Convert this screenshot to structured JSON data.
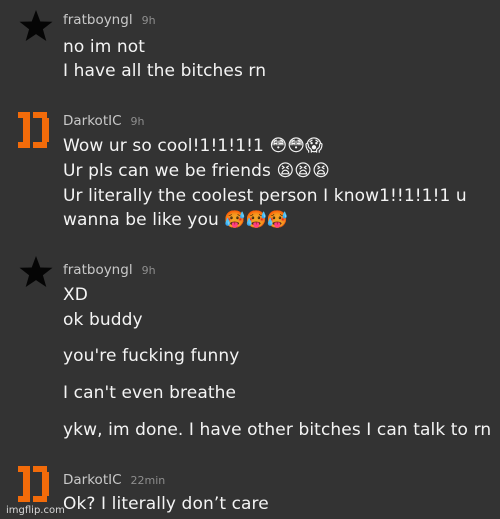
{
  "messages": [
    {
      "username": "fratboyngl",
      "time": "9h",
      "avatar": "star-icon",
      "lines": [
        "no im not",
        "I have all the bitches rn"
      ]
    },
    {
      "username": "DarkotIC",
      "time": "9h",
      "avatar": "darko-logo-icon",
      "lines": [
        "Wow ur so cool!1!1!1!1 😳😳😱",
        "Ur pls can we be friends 😫😫😫",
        "Ur literally the coolest person I know1!!1!1!1 u",
        "wanna be like you 🥵🥵🥵"
      ]
    },
    {
      "username": "fratboyngl",
      "time": "9h",
      "avatar": "star-icon",
      "lines": [
        "XD",
        "ok buddy",
        "you're fucking funny",
        "I can't even breathe",
        "ykw, im done. I have other bitches I can talk to rn"
      ]
    },
    {
      "username": "DarkotIC",
      "time": "22min",
      "avatar": "darko-logo-icon",
      "lines": [
        "Ok? I literally don’t care"
      ]
    }
  ],
  "watermark": "imgflip.com",
  "colors": {
    "background": "#333333",
    "accent": "#f26b0a",
    "text": "#f4f4f4",
    "muted": "#8e8e8e"
  }
}
